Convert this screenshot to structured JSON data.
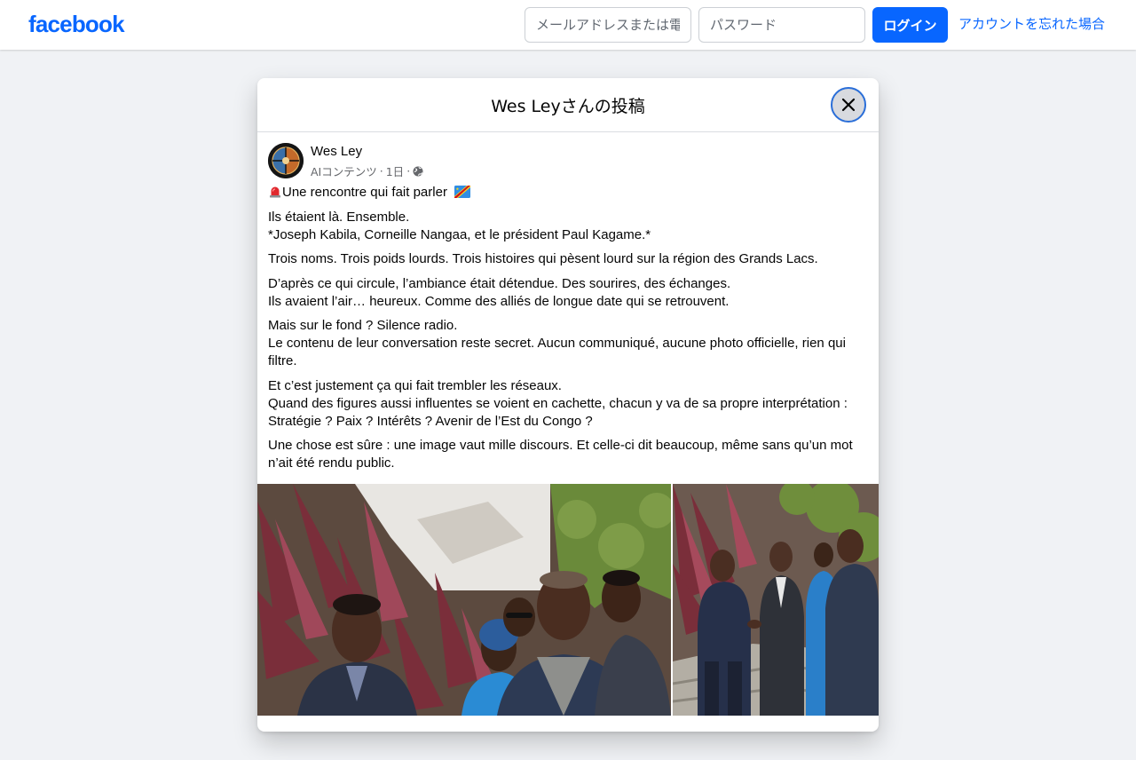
{
  "topbar": {
    "logo": "facebook",
    "email_placeholder": "メールアドレスまたは電話番号",
    "password_placeholder": "パスワード",
    "login_label": "ログイン",
    "forgot_label": "アカウントを忘れた場合"
  },
  "dialog": {
    "title": "Wes Leyさんの投稿"
  },
  "post": {
    "author": "Wes Ley",
    "meta_label": "AIコンテンツ",
    "time": "1日",
    "paragraphs": [
      [
        "Une rencontre qui fait parler"
      ],
      [
        "Ils étaient là. Ensemble.",
        "*Joseph Kabila, Corneille Nangaa, et le président Paul Kagame.*"
      ],
      [
        "Trois noms. Trois poids lourds. Trois histoires qui pèsent lourd sur la région des Grands Lacs."
      ],
      [
        "D’après ce qui circule, l’ambiance était détendue. Des sourires, des échanges.",
        "Ils avaient l’air… heureux. Comme des alliés de longue date qui se retrouvent."
      ],
      [
        "Mais sur le fond ? Silence radio.",
        "Le contenu de leur conversation reste secret. Aucun communiqué, aucune photo officielle, rien qui filtre."
      ],
      [
        "Et c’est justement ça qui fait trembler les réseaux.",
        "Quand des figures aussi influentes se voient en cachette, chacun y va de sa propre interprétation :",
        "Stratégie ? Paix ? Intérêts ? Avenir de l’Est du Congo ?"
      ],
      [
        "Une chose est sûre : une image vaut mille discours. Et celle-ci dit beaucoup, même sans qu’un mot n’ait été rendu public."
      ]
    ]
  },
  "colors": {
    "brand": "#0866ff",
    "page_bg": "#f0f2f5",
    "meta_text": "#65676b"
  },
  "icons": {
    "close": "close-icon",
    "globe": "globe-icon",
    "siren": "siren-emoji-icon",
    "flag": "drc-flag-icon"
  }
}
